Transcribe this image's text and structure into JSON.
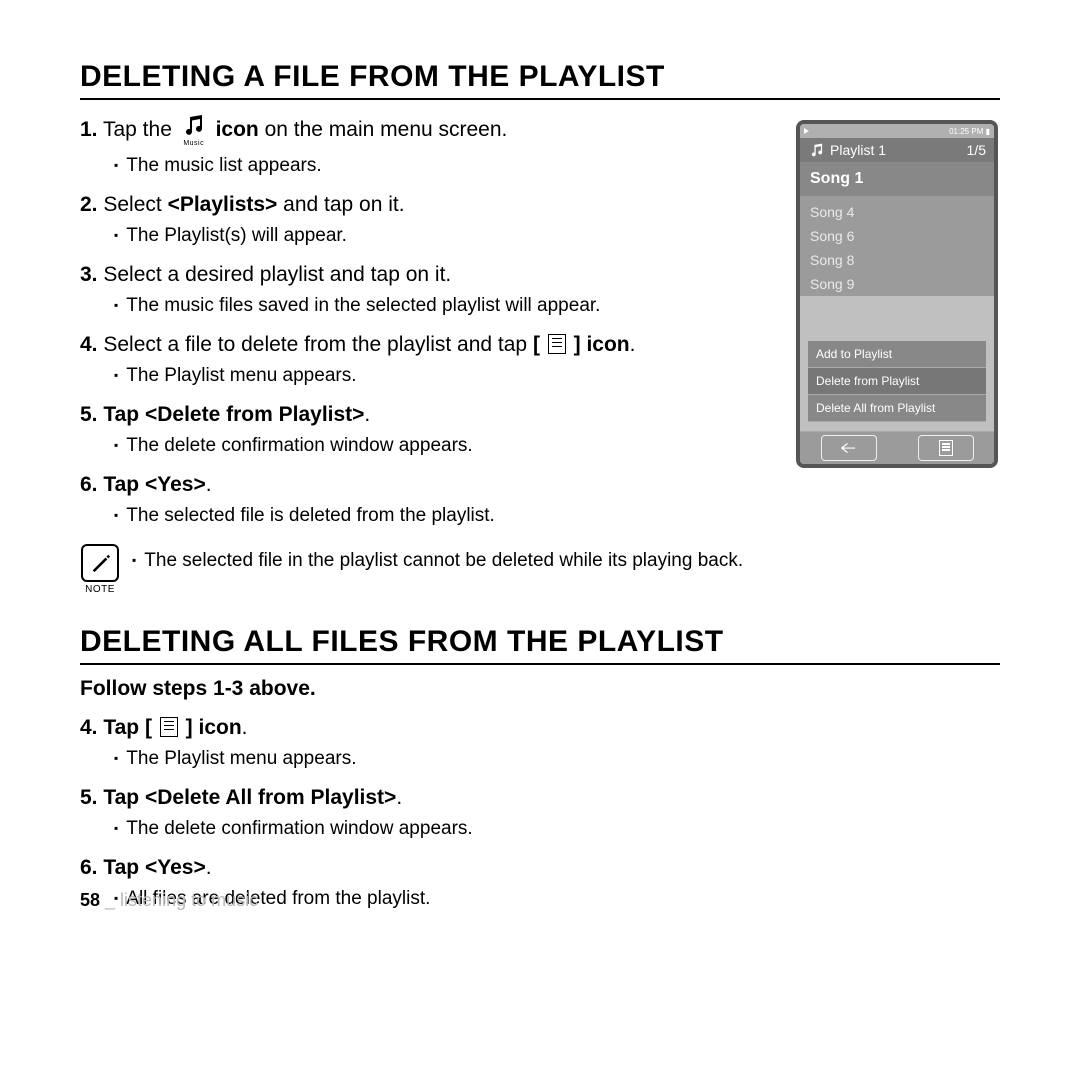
{
  "section1": {
    "title": "DELETING A FILE FROM THE PLAYLIST",
    "steps": [
      {
        "num": "1.",
        "pre": "Tap the ",
        "icon": "music",
        "iconlabel": "Music",
        "post": " icon",
        "tail": " on the main menu screen.",
        "boldpost": true,
        "sub": "The music list appears."
      },
      {
        "num": "2.",
        "pre": "Select ",
        "bold": "<Playlists>",
        "tail": " and tap on it.",
        "sub": "The Playlist(s) will appear."
      },
      {
        "num": "3.",
        "text": "Select a desired playlist and tap on it.",
        "sub": "The music files saved in the selected playlist will appear."
      },
      {
        "num": "4.",
        "pre": "Select a file to delete from the playlist and tap ",
        "bold": "[",
        "menuicon": true,
        "bold2": "] icon",
        "tail": ".",
        "sub": "The Playlist menu appears."
      },
      {
        "num": "5.",
        "pre": "Tap ",
        "bold": "<Delete from Playlist>",
        "tail": ".",
        "allbold": true,
        "sub": "The delete confirmation window appears."
      },
      {
        "num": "6.",
        "pre": "Tap ",
        "bold": "<Yes>",
        "tail": ".",
        "allbold": true,
        "sub": "The selected file is deleted from the playlist."
      }
    ],
    "note": {
      "label": "NOTE",
      "text": "The selected file in the playlist cannot be deleted while its playing back."
    }
  },
  "section2": {
    "title": "DELETING ALL FILES FROM THE PLAYLIST",
    "pre": "Follow steps 1-3 above.",
    "steps": [
      {
        "num": "4.",
        "pre": "Tap ",
        "bold": "[",
        "menuicon": true,
        "bold2": "] icon",
        "tail": ".",
        "allbold": true,
        "sub": "The Playlist menu appears."
      },
      {
        "num": "5.",
        "pre": "Tap ",
        "bold": "<Delete All from Playlist>",
        "tail": ".",
        "allbold": true,
        "sub": "The delete confirmation window appears."
      },
      {
        "num": "6.",
        "pre": "Tap ",
        "bold": "<Yes>",
        "tail": ".",
        "allbold": true,
        "sub": "All files are deleted from the playlist."
      }
    ]
  },
  "device": {
    "time": "01:25 PM",
    "batt": "▮",
    "playlist": "Playlist 1",
    "count": "1/5",
    "selected": "Song 1",
    "songs": [
      "Song 4",
      "Song 6",
      "Song 8",
      "Song 9"
    ],
    "menu": [
      "Add to Playlist",
      "Delete from Playlist",
      "Delete All from Playlist"
    ]
  },
  "footer": {
    "page": "58",
    "sep": " _ ",
    "chapter": "listening to music"
  }
}
